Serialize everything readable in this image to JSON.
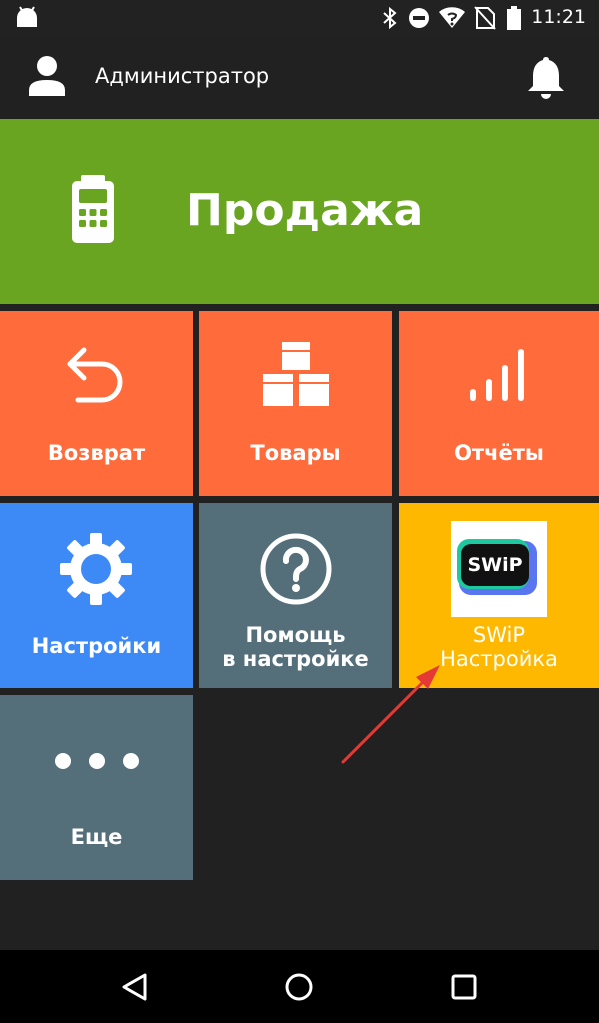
{
  "status_bar": {
    "time": "11:21",
    "icons": [
      "android-icon",
      "bluetooth-icon",
      "dnd-icon",
      "wifi-icon",
      "no-sim-icon",
      "battery-icon"
    ]
  },
  "header": {
    "user_name": "Администратор",
    "icons": [
      "user-icon",
      "bell-icon"
    ]
  },
  "tiles": {
    "sale": {
      "label": "Продажа",
      "color": "#6aa521",
      "icon": "pos-terminal-icon"
    },
    "return": {
      "label": "Возврат",
      "color": "#ff6b3a",
      "icon": "undo-arrow-icon"
    },
    "goods": {
      "label": "Товары",
      "color": "#ff6b3a",
      "icon": "boxes-icon"
    },
    "reports": {
      "label": "Отчёты",
      "color": "#ff6b3a",
      "icon": "bar-signal-icon"
    },
    "settings": {
      "label": "Настройки",
      "color": "#3d8af7",
      "icon": "gear-icon"
    },
    "help": {
      "label_line1": "Помощь",
      "label_line2": "в настройке",
      "color": "#546e7a",
      "icon": "question-icon"
    },
    "swip": {
      "label_line1": "SWiP",
      "label_line2": "Настройка",
      "logo_text": "SWiP",
      "color": "#ffb800",
      "icon": "swip-logo-icon"
    },
    "more": {
      "label": "Еще",
      "color": "#546e7a",
      "icon": "dots-icon"
    }
  },
  "annotation": {
    "arrow_color": "#e53935"
  },
  "nav_bar": {
    "icons": [
      "back-icon",
      "home-icon",
      "recents-icon"
    ]
  }
}
